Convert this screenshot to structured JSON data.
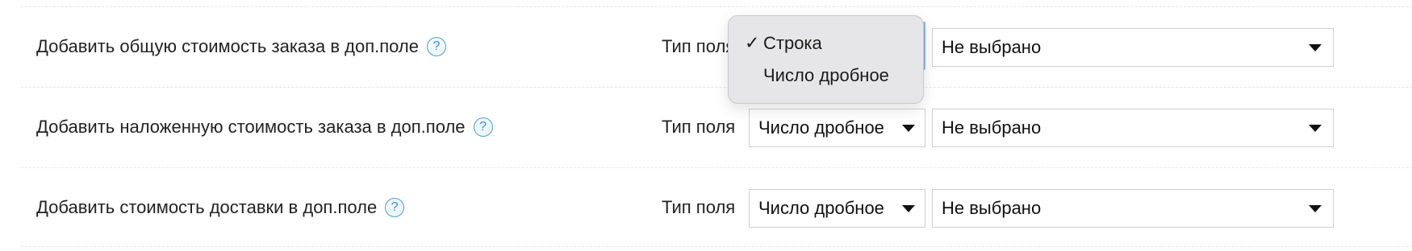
{
  "rows": [
    {
      "label": "Добавить общую стоимость заказа в доп.поле",
      "help": "?",
      "field_type_label": "Тип поля",
      "type_select_value": "Строка",
      "value_select": "Не выбрано"
    },
    {
      "label": "Добавить наложенную стоимость заказа в доп.поле",
      "help": "?",
      "field_type_label": "Тип поля",
      "type_select_value": "Число дробное",
      "value_select": "Не выбрано"
    },
    {
      "label": "Добавить стоимость доставки в доп.поле",
      "help": "?",
      "field_type_label": "Тип поля",
      "type_select_value": "Число дробное",
      "value_select": "Не выбрано"
    }
  ],
  "dropdown": {
    "open_for_row": 0,
    "checkmark": "✓",
    "options": [
      "Строка",
      "Число дробное"
    ],
    "selected": "Строка"
  },
  "colors": {
    "help_icon": "#3a8fd0",
    "menu_bg": "#e6e6e8",
    "focus_ring": "#8ab3f0",
    "select_border": "#cfcfcf"
  }
}
